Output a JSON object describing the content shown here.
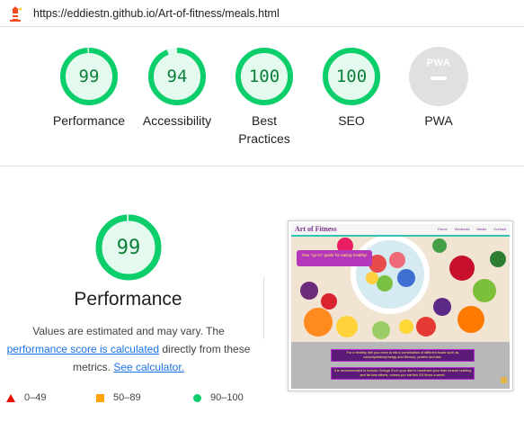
{
  "header": {
    "url": "https://eddiestn.github.io/Art-of-fitness/meals.html",
    "logo_icon": "lighthouse-icon"
  },
  "colors": {
    "pass_green": "#0cce6b",
    "pass_text": "#0c7f3b",
    "pass_fill": "#e5faef",
    "average_orange": "#ffa400",
    "fail_red": "#eb0f00",
    "link_blue": "#1a73e8",
    "pwa_gray": "#e0e0e0"
  },
  "gauges": [
    {
      "score": "99",
      "value": 99,
      "label": "Performance"
    },
    {
      "score": "94",
      "value": 94,
      "label": "Accessibility"
    },
    {
      "score": "100",
      "value": 100,
      "label_line1": "Best",
      "label_line2": "Practices"
    },
    {
      "score": "100",
      "value": 100,
      "label": "SEO"
    }
  ],
  "pwa": {
    "badge_text": "PWA",
    "label": "PWA",
    "icon": "pwa-badge-icon"
  },
  "performance": {
    "score": "99",
    "value": 99,
    "title": "Performance",
    "desc_part1": "Values are estimated and may vary. The",
    "link1": "performance score is calculated",
    "desc_part2": " directly from these",
    "desc_part3": "metrics. ",
    "link2": "See calculator."
  },
  "legend": [
    {
      "range": "0–49",
      "shape": "triangle-icon"
    },
    {
      "range": "50–89",
      "shape": "square-icon"
    },
    {
      "range": "90–100",
      "shape": "circle-icon"
    }
  ],
  "screenshot": {
    "brand": "Art of Fitness",
    "nav_links": [
      "Home",
      "Workouts",
      "Meals",
      "Contact"
    ],
    "title": "Your \"go-to\" guide for eating healthy!",
    "box1": "For a healthy diet you need to eat a combination of different foods such as carbohydrates(energy and fibrous), protein and fats.",
    "box2": "It is recommended to include Omega 3's in your diet to maximize your lean muscle building and fat loss efforts, unless you eat fish 2/3 times a week."
  }
}
